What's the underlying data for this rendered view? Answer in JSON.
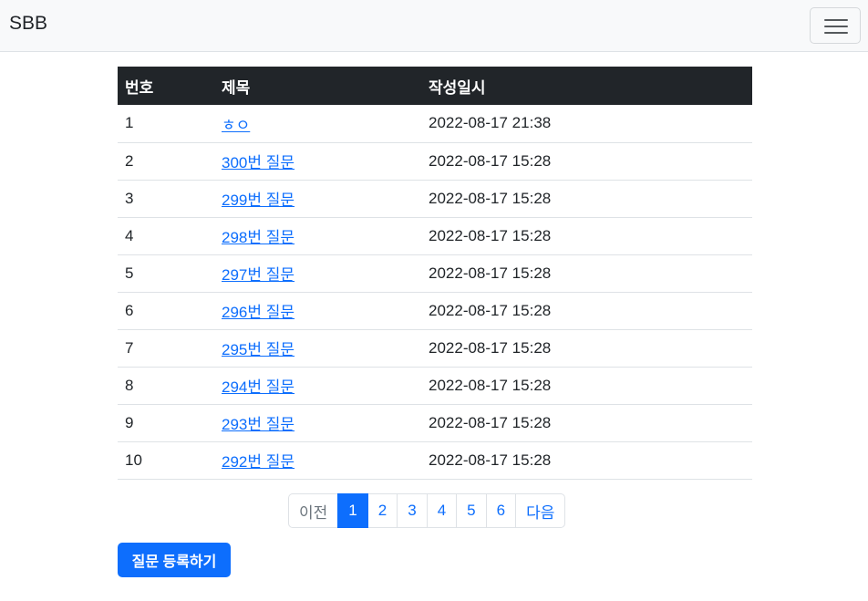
{
  "navbar": {
    "brand": "SBB",
    "toggler_icon": "hamburger-menu-icon"
  },
  "table": {
    "headers": [
      "번호",
      "제목",
      "작성일시"
    ],
    "rows": [
      {
        "num": "1",
        "title": "ㅎㅇ",
        "date": "2022-08-17 21:38"
      },
      {
        "num": "2",
        "title": "300번 질문",
        "date": "2022-08-17 15:28"
      },
      {
        "num": "3",
        "title": "299번 질문",
        "date": "2022-08-17 15:28"
      },
      {
        "num": "4",
        "title": "298번 질문",
        "date": "2022-08-17 15:28"
      },
      {
        "num": "5",
        "title": "297번 질문",
        "date": "2022-08-17 15:28"
      },
      {
        "num": "6",
        "title": "296번 질문",
        "date": "2022-08-17 15:28"
      },
      {
        "num": "7",
        "title": "295번 질문",
        "date": "2022-08-17 15:28"
      },
      {
        "num": "8",
        "title": "294번 질문",
        "date": "2022-08-17 15:28"
      },
      {
        "num": "9",
        "title": "293번 질문",
        "date": "2022-08-17 15:28"
      },
      {
        "num": "10",
        "title": "292번 질문",
        "date": "2022-08-17 15:28"
      }
    ]
  },
  "pagination": {
    "prev": "이전",
    "pages": [
      "1",
      "2",
      "3",
      "4",
      "5",
      "6"
    ],
    "active": "1",
    "next": "다음"
  },
  "actions": {
    "create_label": "질문 등록하기"
  },
  "colors": {
    "primary": "#0d6efd",
    "header_bg": "#212529",
    "navbar_bg": "#f8f9fa"
  }
}
